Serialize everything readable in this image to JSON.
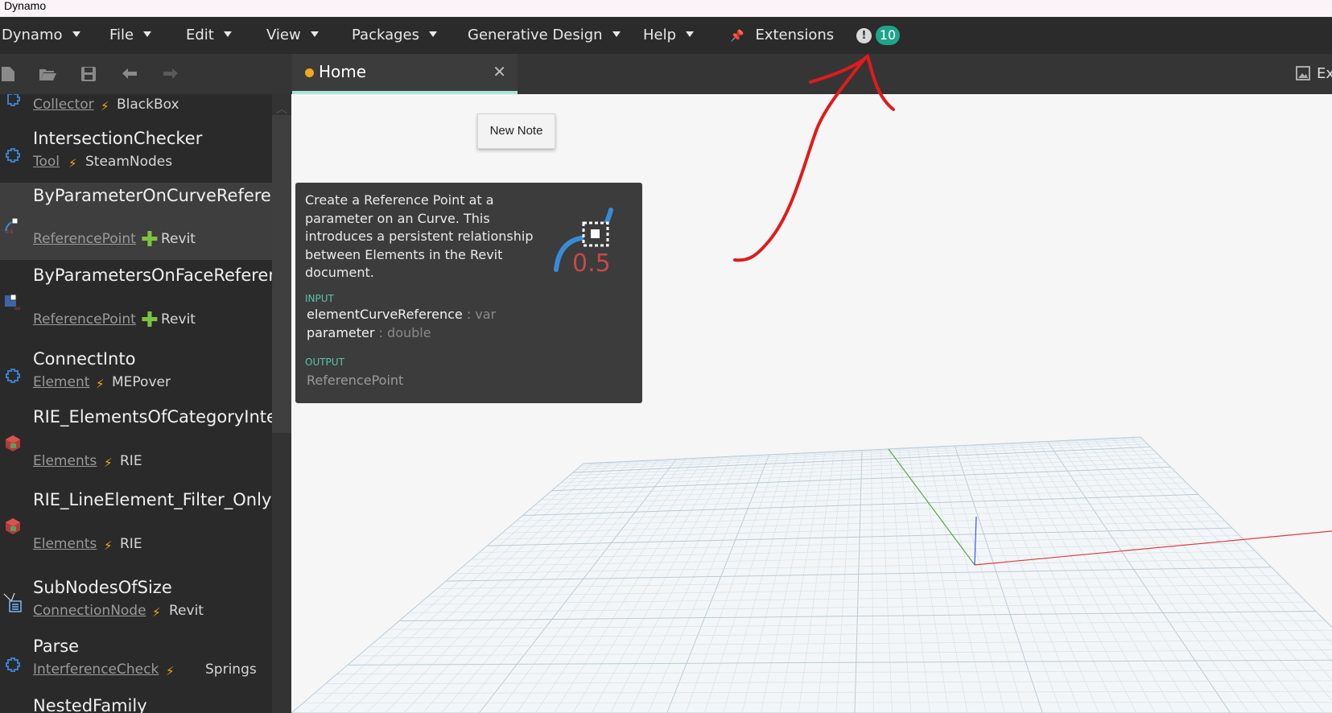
{
  "window": {
    "title": "Dynamo"
  },
  "menu": {
    "items": [
      {
        "label": "Dynamo"
      },
      {
        "label": "File"
      },
      {
        "label": "Edit"
      },
      {
        "label": "View"
      },
      {
        "label": "Packages"
      },
      {
        "label": "Generative Design"
      },
      {
        "label": "Help"
      }
    ],
    "extensions_label": "Extensions",
    "notification_icon": "!",
    "notification_count": "10"
  },
  "toolbar": {
    "icons": [
      "new-file-icon",
      "open-folder-icon",
      "save-icon",
      "undo-icon",
      "redo-icon"
    ],
    "export_label": "Ex"
  },
  "tab": {
    "label": "Home",
    "close": "✕"
  },
  "library": {
    "items": [
      {
        "title": "",
        "category": "Collector",
        "sep": "⚡",
        "package": "BlackBox"
      },
      {
        "title": "IntersectionChecker",
        "category": "Tool",
        "sep": "⚡",
        "package": "SteamNodes"
      },
      {
        "title": "ByParameterOnCurveReferen",
        "category": "ReferencePoint",
        "sep": "✚",
        "package": "Revit"
      },
      {
        "title": "ByParametersOnFaceReferen",
        "category": "ReferencePoint",
        "sep": "✚",
        "package": "Revit"
      },
      {
        "title": "ConnectInto",
        "category": "Element",
        "sep": "⚡",
        "package": "MEPover"
      },
      {
        "title": "RIE_ElementsOfCategoryInte",
        "category": "Elements",
        "sep": "⚡",
        "package": "RIE"
      },
      {
        "title": "RIE_LineElement_Filter_Only",
        "category": "Elements",
        "sep": "⚡",
        "package": "RIE"
      },
      {
        "title": "SubNodesOfSize",
        "category": "ConnectionNode",
        "sep": "⚡",
        "package": "Revit"
      },
      {
        "title": "Parse",
        "category": "InterferenceCheck",
        "sep": "⚡",
        "package": "Springs"
      },
      {
        "title": "NestedFamily",
        "category": "",
        "sep": "",
        "package": ""
      }
    ]
  },
  "context_menu": {
    "new_note": "New Note"
  },
  "tooltip": {
    "description": "Create a Reference Point at a parameter on an Curve. This introduces a persistent relationship between Elements in the Revit document.",
    "input_header": "INPUT",
    "inputs": [
      {
        "name": "elementCurveReference",
        "type": " : var"
      },
      {
        "name": "parameter",
        "type": " : double"
      }
    ],
    "output_header": "OUTPUT",
    "output": "ReferencePoint",
    "icon_value": "0.5"
  },
  "colors": {
    "accent": "#1fa58a",
    "tab_underline": "#a7e5d9",
    "dot": "#f3a81b",
    "annotation": "#e01b1b"
  }
}
